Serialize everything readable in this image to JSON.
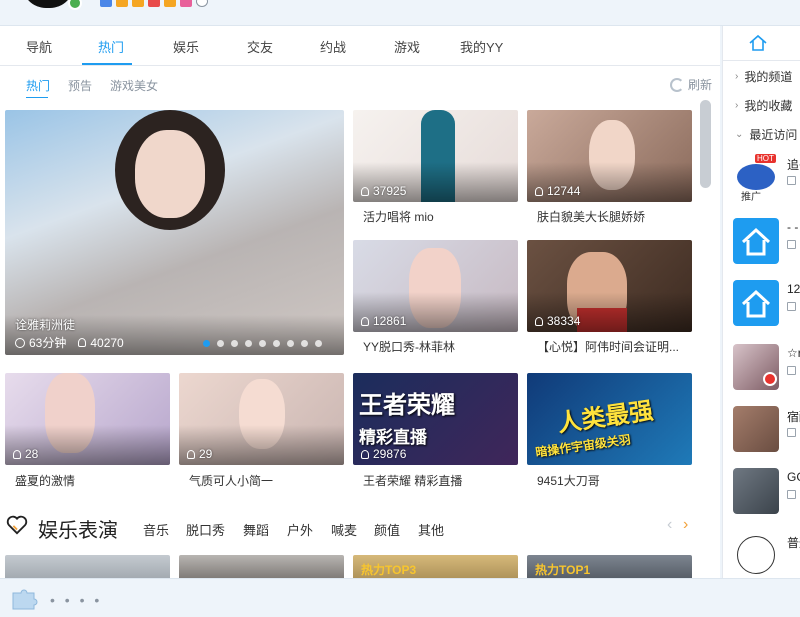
{
  "main_nav": {
    "tabs": [
      "导航",
      "热门",
      "娱乐",
      "交友",
      "约战",
      "游戏",
      "我的YY"
    ],
    "active_index": 1
  },
  "sub_nav": {
    "tabs": [
      "热门",
      "预告",
      "游戏美女"
    ],
    "refresh_label": "刷新"
  },
  "feature": {
    "title": "诠雅莉洲徒",
    "duration": "63分钟",
    "viewers": "40270"
  },
  "cards": [
    {
      "viewers": "37925",
      "caption": "活力唱将 mio"
    },
    {
      "viewers": "12744",
      "caption": "肤白貌美大长腿娇娇"
    },
    {
      "viewers": "12861",
      "caption": "YY脱口秀-林菲林"
    },
    {
      "viewers": "38334",
      "caption": "【心悦】阿伟时间会证明..."
    },
    {
      "viewers": "28",
      "caption": "盛夏的激情"
    },
    {
      "viewers": "29",
      "caption": "气质可人小简一"
    },
    {
      "viewers": "29876",
      "caption": "王者荣耀 精彩直播",
      "overlay_top": "王者荣耀",
      "overlay_bottom": "精彩直播"
    },
    {
      "viewers": "",
      "caption": "9451大刀哥",
      "overlay_top": "人类最强",
      "overlay_bottom": "暗操作宇宙级关羽"
    }
  ],
  "entertainment": {
    "title": "娱乐表演",
    "categories": [
      "音乐",
      "脱口秀",
      "舞蹈",
      "户外",
      "喊麦",
      "颜值",
      "其他"
    ],
    "preview_tags": [
      "热力TOP3",
      "热力TOP1"
    ]
  },
  "right_panel": {
    "links": [
      "我的频道",
      "我的收藏",
      "最近访问"
    ],
    "items": [
      {
        "name": "追子",
        "badge": "HOT",
        "tag": "推广"
      },
      {
        "name": "- -",
        "badge": "",
        "tag": ""
      },
      {
        "name": "12",
        "badge": "",
        "tag": ""
      },
      {
        "name": "☆r",
        "badge": "",
        "tag": ""
      },
      {
        "name": "宿醉",
        "badge": "",
        "tag": ""
      },
      {
        "name": "GG",
        "badge": "",
        "tag": ""
      },
      {
        "name": "普通",
        "badge": "",
        "tag": ""
      }
    ]
  },
  "bottom_bar": {
    "dots": "• • • •"
  },
  "colors": {
    "accent": "#1e9cf0",
    "arrow_active": "#f2a23b",
    "background": "#eef4fa"
  }
}
